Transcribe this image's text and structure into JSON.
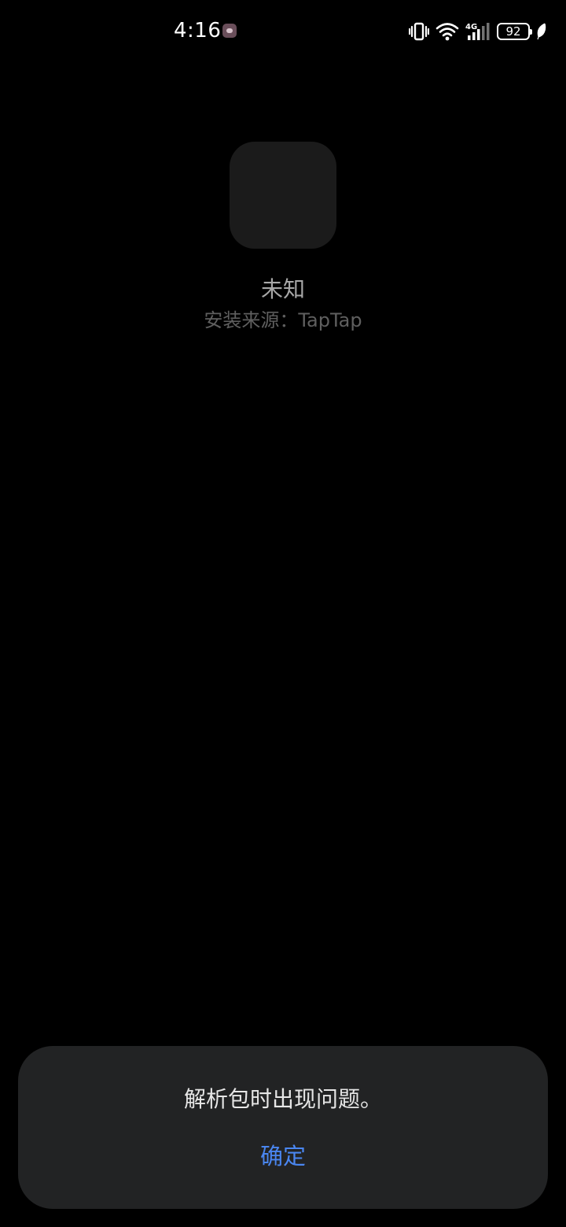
{
  "status_bar": {
    "time": "4:16",
    "battery_level": "92",
    "network_type": "4G",
    "icons": [
      "app-notification-icon",
      "vibrate-icon",
      "wifi-icon",
      "cellular-signal-icon",
      "battery-icon",
      "battery-saver-leaf-icon"
    ]
  },
  "app": {
    "name": "未知",
    "source": "安装来源：TapTap"
  },
  "dialog": {
    "message": "解析包时出现问题。",
    "confirm_label": "确定"
  },
  "colors": {
    "background": "#000000",
    "dialog_background": "#222324",
    "accent": "#4a86f0"
  }
}
